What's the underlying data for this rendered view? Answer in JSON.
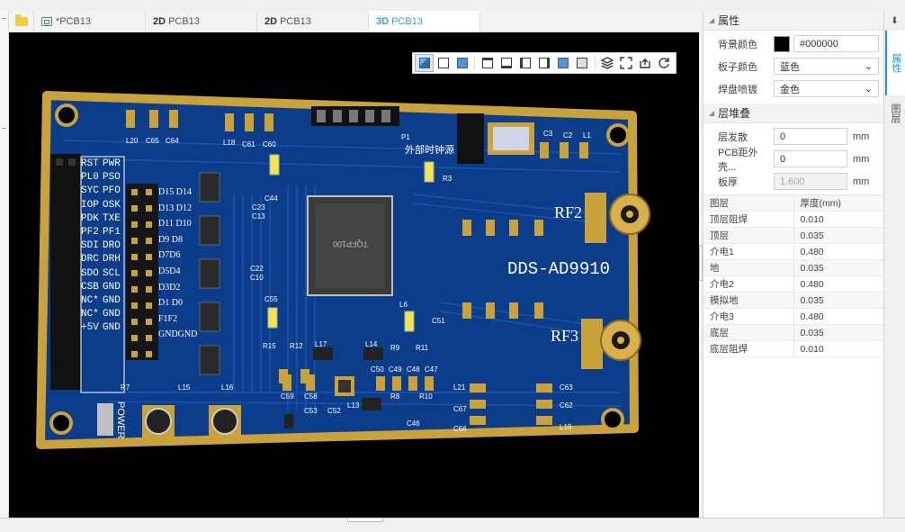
{
  "tabs": [
    {
      "prefix": "",
      "label": "*PCB13",
      "kind": "schematic"
    },
    {
      "prefix": "2D",
      "label": "PCB13",
      "kind": "2d"
    },
    {
      "prefix": "2D",
      "label": "PCB13",
      "kind": "2d"
    },
    {
      "prefix": "3D",
      "label": "PCB13",
      "kind": "3d",
      "active": true
    }
  ],
  "view_toolbar": {
    "icons": [
      "view-3d-icon",
      "wireframe-icon",
      "solid-icon",
      "top-view-icon",
      "bottom-view-icon",
      "left-view-icon",
      "right-view-icon",
      "front-view-icon",
      "back-view-icon",
      "layers-icon",
      "fullscreen-icon",
      "export-icon",
      "refresh-icon"
    ]
  },
  "board": {
    "title": "DDS-AD9910",
    "rf2": "RF2",
    "rf3": "RF3",
    "ext_clock": "外部时钟源",
    "power": "POWER",
    "ic_label": "TQFP100",
    "left_header": [
      "RST",
      "PWR",
      "PL0",
      "PSO",
      "SYC",
      "PFO",
      "IOP",
      "OSK",
      "PDK",
      "TXE",
      "PF2",
      "PF1",
      "SDI",
      "DRO",
      "DRC",
      "DRH",
      "SDO",
      "SCL",
      "CSB",
      "GND",
      "NC*",
      "GND",
      "NC*",
      "GND",
      "+5V",
      "GND"
    ],
    "mid_labels": [
      "D15 D14",
      "D13 D12",
      "D11 D10",
      "D9 D8",
      "D7D6",
      "D5D4",
      "D3D2",
      "D1 D0",
      "F1F2",
      "GNDGND"
    ],
    "refs": [
      "L20",
      "C65",
      "C64",
      "L18",
      "C61",
      "C60",
      "P1",
      "C3",
      "C2",
      "L1",
      "R3",
      "C44",
      "C23",
      "C13",
      "C22",
      "C10",
      "C55",
      "L6",
      "C51",
      "R15",
      "R12",
      "L17",
      "L14",
      "R9",
      "R11",
      "C50",
      "C49",
      "C48",
      "C47",
      "C59",
      "C58",
      "R8",
      "R10",
      "L13",
      "C53",
      "C52",
      "C63",
      "C62",
      "L19",
      "L15",
      "L16",
      "R7",
      "C46",
      "L21",
      "C67",
      "C66"
    ]
  },
  "panel": {
    "properties_title": "属性",
    "bg_color_label": "背景颜色",
    "bg_color_value": "#000000",
    "board_color_label": "板子颜色",
    "board_color_value": "蓝色",
    "pad_plating_label": "焊盘喷镀",
    "pad_plating_value": "金色",
    "stackup_title": "层堆叠",
    "layer_spread_label": "层发散",
    "layer_spread_value": "0",
    "layer_spread_unit": "mm",
    "pcb_outline_label": "PCB距外壳...",
    "pcb_outline_value": "0",
    "pcb_outline_unit": "mm",
    "thickness_label": "板厚",
    "thickness_value": "1.600",
    "thickness_unit": "mm",
    "table_headers": [
      "图层",
      "厚度(mm)"
    ],
    "layers": [
      [
        "顶层阻焊",
        "0.010"
      ],
      [
        "顶层",
        "0.035"
      ],
      [
        "介电1",
        "0.480"
      ],
      [
        "地",
        "0.035"
      ],
      [
        "介电2",
        "0.480"
      ],
      [
        "模拟地",
        "0.035"
      ],
      [
        "介电3",
        "0.480"
      ],
      [
        "底层",
        "0.035"
      ],
      [
        "底层阻焊",
        "0.010"
      ]
    ]
  },
  "vtabs": {
    "pin": "⬇",
    "tab1": "属性",
    "tab2": "图层"
  },
  "colors": {
    "board": "#0b3d8a",
    "board_trace": "#1a5bc0",
    "gold": "#c9a23a",
    "accent": "#1d8fe0"
  }
}
